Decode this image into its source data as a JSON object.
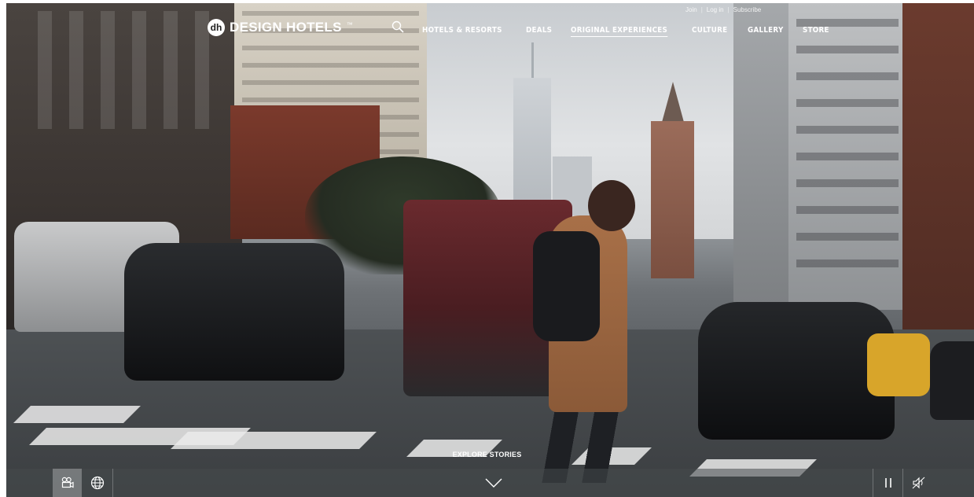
{
  "brand": {
    "logo_mark": "dh",
    "name": "DESIGN HOTELS",
    "trademark": "™"
  },
  "top_links": [
    {
      "label": "Join"
    },
    {
      "label": "Log in"
    },
    {
      "label": "Subscribe"
    }
  ],
  "top_links_separator": "|",
  "nav": {
    "search_icon": "search-icon",
    "items": [
      {
        "label": "HOTELS & RESORTS",
        "active": false
      },
      {
        "label": "DEALS",
        "active": false
      },
      {
        "label": "ORIGINAL EXPERIENCES",
        "active": true
      },
      {
        "label": "CULTURE",
        "active": false
      },
      {
        "label": "GALLERY",
        "active": false
      },
      {
        "label": "STORE",
        "active": false
      }
    ]
  },
  "hero": {
    "explore_label": "EXPLORE STORIES"
  },
  "bottom_bar": {
    "icons": [
      "video-camera-icon",
      "globe-icon",
      "chevron-down-icon",
      "pause-icon",
      "mute-icon"
    ]
  },
  "colors": {
    "text": "#ffffff",
    "bar": "#464a4d"
  }
}
